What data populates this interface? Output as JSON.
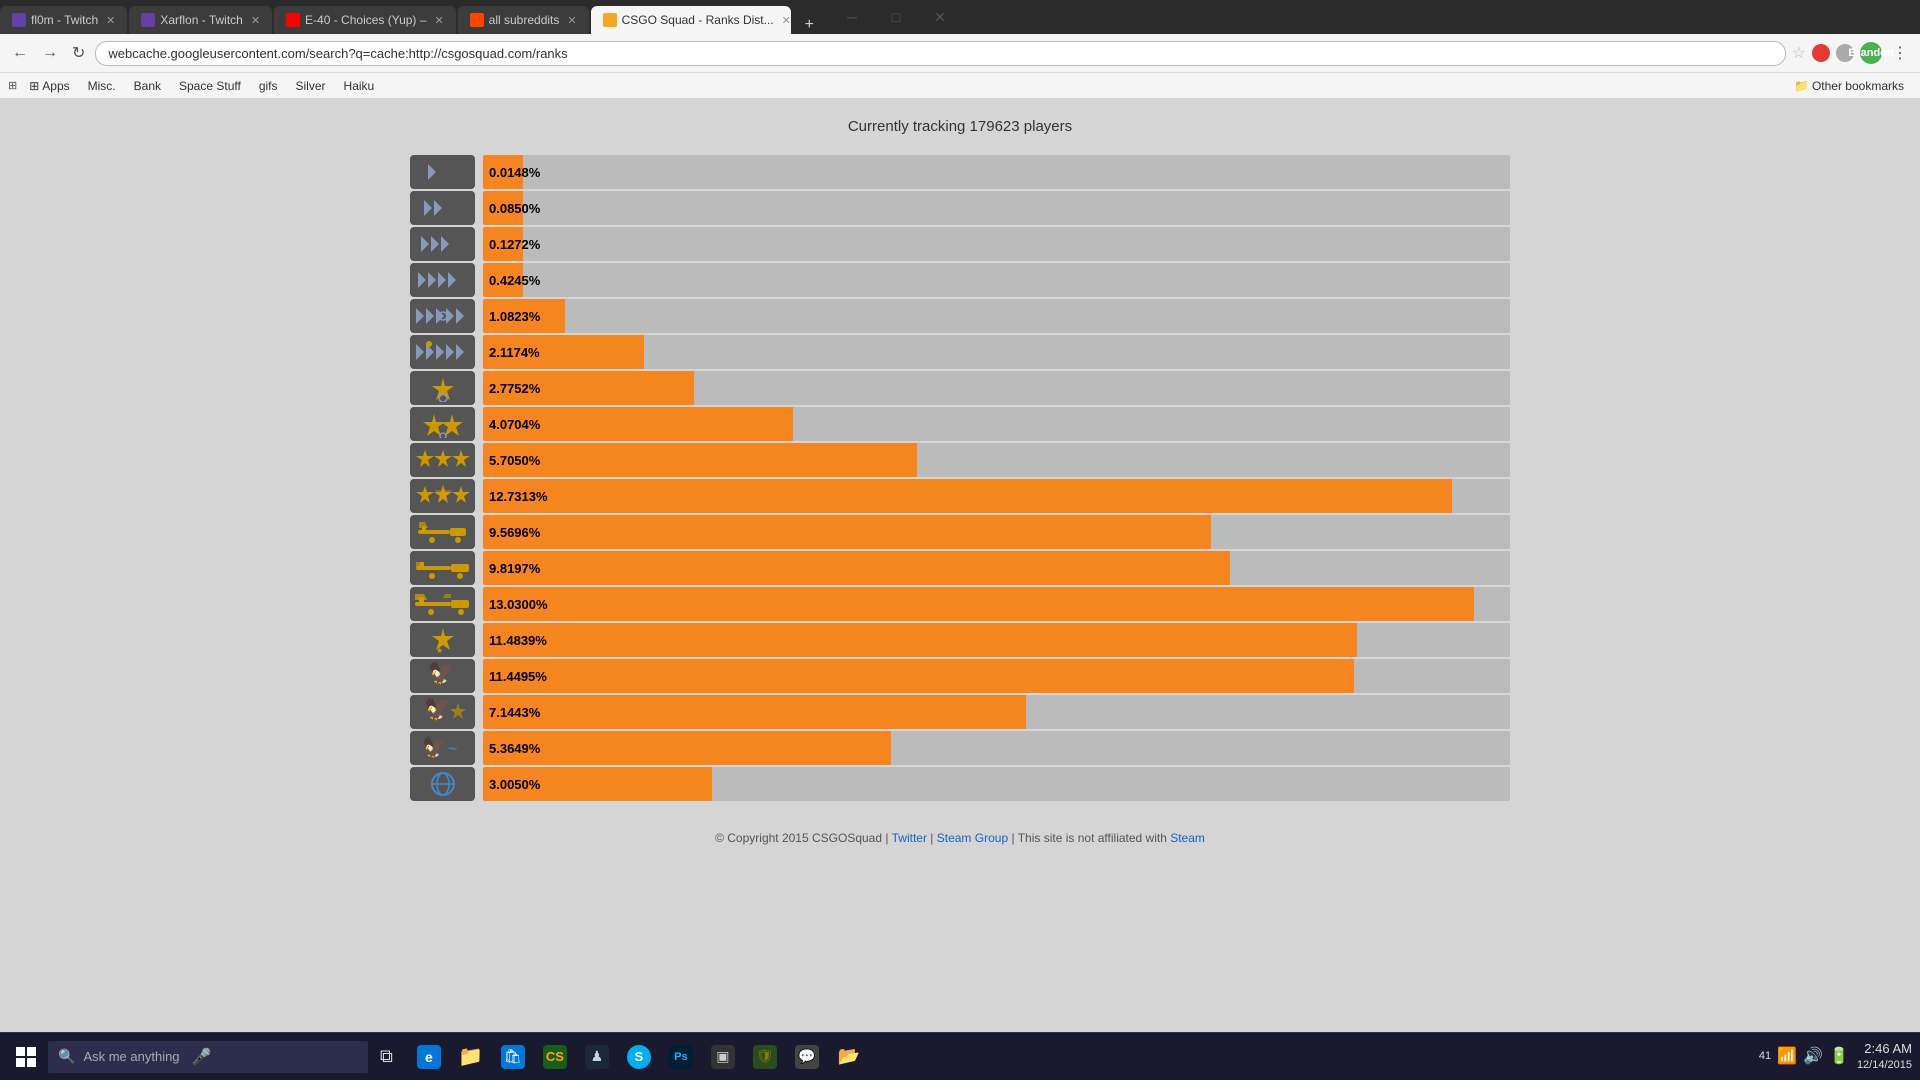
{
  "browser": {
    "tabs": [
      {
        "id": "tab1",
        "favicon": "twitch",
        "label": "fl0m - Twitch",
        "active": false
      },
      {
        "id": "tab2",
        "favicon": "twitch",
        "label": "Xarflon - Twitch",
        "active": false
      },
      {
        "id": "tab3",
        "favicon": "youtube",
        "label": "E-40 - Choices (Yup) –",
        "active": false
      },
      {
        "id": "tab4",
        "favicon": "reddit",
        "label": "all subreddits",
        "active": false
      },
      {
        "id": "tab5",
        "favicon": "csgo",
        "label": "CSGO Squad - Ranks Dist...",
        "active": true
      }
    ],
    "address": "webcache.googleusercontent.com/search?q=cache:http://csgosquad.com/ranks",
    "user": "Brandon"
  },
  "bookmarks": [
    {
      "label": "Apps"
    },
    {
      "label": "Misc."
    },
    {
      "label": "Bank"
    },
    {
      "label": "Space Stuff"
    },
    {
      "label": "gifs"
    },
    {
      "label": "Silver"
    },
    {
      "label": "Haiku"
    },
    {
      "label": "Other bookmarks",
      "align": "right"
    }
  ],
  "page": {
    "tracking_text": "Currently tracking 179623 players",
    "ranks": [
      {
        "label": "Silver I",
        "pct": "0.0148%",
        "bar_pct": 0.0148,
        "type": "arrow1"
      },
      {
        "label": "Silver II",
        "pct": "0.0850%",
        "bar_pct": 0.085,
        "type": "arrow2"
      },
      {
        "label": "Silver III",
        "pct": "0.1272%",
        "bar_pct": 0.1272,
        "type": "arrow3"
      },
      {
        "label": "Silver IV",
        "pct": "0.4245%",
        "bar_pct": 0.4245,
        "type": "arrow4"
      },
      {
        "label": "Silver Elite",
        "pct": "1.0823%",
        "bar_pct": 1.0823,
        "type": "arrow5"
      },
      {
        "label": "Silver Elite Master",
        "pct": "2.1174%",
        "bar_pct": 2.1174,
        "type": "arrow6"
      },
      {
        "label": "Gold Nova I",
        "pct": "2.7752%",
        "bar_pct": 2.7752,
        "type": "star1"
      },
      {
        "label": "Gold Nova II",
        "pct": "4.0704%",
        "bar_pct": 4.0704,
        "type": "star2"
      },
      {
        "label": "Gold Nova III",
        "pct": "5.7050%",
        "bar_pct": 5.705,
        "type": "star3"
      },
      {
        "label": "Gold Nova Master",
        "pct": "12.7313%",
        "bar_pct": 12.7313,
        "type": "star4"
      },
      {
        "label": "MG1",
        "pct": "9.5696%",
        "bar_pct": 9.5696,
        "type": "ak1"
      },
      {
        "label": "MG2",
        "pct": "9.8197%",
        "bar_pct": 9.8197,
        "type": "ak2"
      },
      {
        "label": "MGE",
        "pct": "13.0300%",
        "bar_pct": 13.03,
        "type": "ak3"
      },
      {
        "label": "DMG",
        "pct": "11.4839%",
        "bar_pct": 11.4839,
        "type": "star_eagle"
      },
      {
        "label": "LE",
        "pct": "11.4495%",
        "bar_pct": 11.4495,
        "type": "eagle1"
      },
      {
        "label": "LEM",
        "pct": "7.1443%",
        "bar_pct": 7.1443,
        "type": "eagle2"
      },
      {
        "label": "SMFC",
        "pct": "5.3649%",
        "bar_pct": 5.3649,
        "type": "eagle3"
      },
      {
        "label": "GE",
        "pct": "3.0050%",
        "bar_pct": 3.005,
        "type": "globe"
      }
    ]
  },
  "footer": {
    "text": "© Copyright 2015 CSGOSquad | ",
    "twitter": "Twitter",
    "separator1": " | ",
    "steam_group": "Steam Group",
    "separator2": " | This site is not affiliated with ",
    "steam": "Steam"
  },
  "taskbar": {
    "search_placeholder": "Ask me anything",
    "apps": [
      {
        "name": "task-view",
        "icon": "⧉",
        "color": "#0078d7"
      },
      {
        "name": "edge",
        "icon": "e",
        "color": "#0078d7"
      },
      {
        "name": "explorer",
        "icon": "📁",
        "color": "#ffb900"
      },
      {
        "name": "store",
        "icon": "🛍",
        "color": "#0078d7"
      },
      {
        "name": "csgo",
        "icon": "🎮",
        "color": "#2d4a22"
      },
      {
        "name": "steam",
        "icon": "♟",
        "color": "#1b2838"
      },
      {
        "name": "skype",
        "icon": "S",
        "color": "#00aff0"
      },
      {
        "name": "photoshop",
        "icon": "Ps",
        "color": "#001e36"
      },
      {
        "name": "app8",
        "icon": "▣",
        "color": "#555"
      },
      {
        "name": "app9",
        "icon": "🛡",
        "color": "#333"
      },
      {
        "name": "app10",
        "icon": "💬",
        "color": "#555"
      },
      {
        "name": "app11",
        "icon": "📂",
        "color": "#555"
      }
    ],
    "tray": {
      "notification_count": "41",
      "time": "2:46 AM",
      "date": "12/14/2015"
    }
  }
}
